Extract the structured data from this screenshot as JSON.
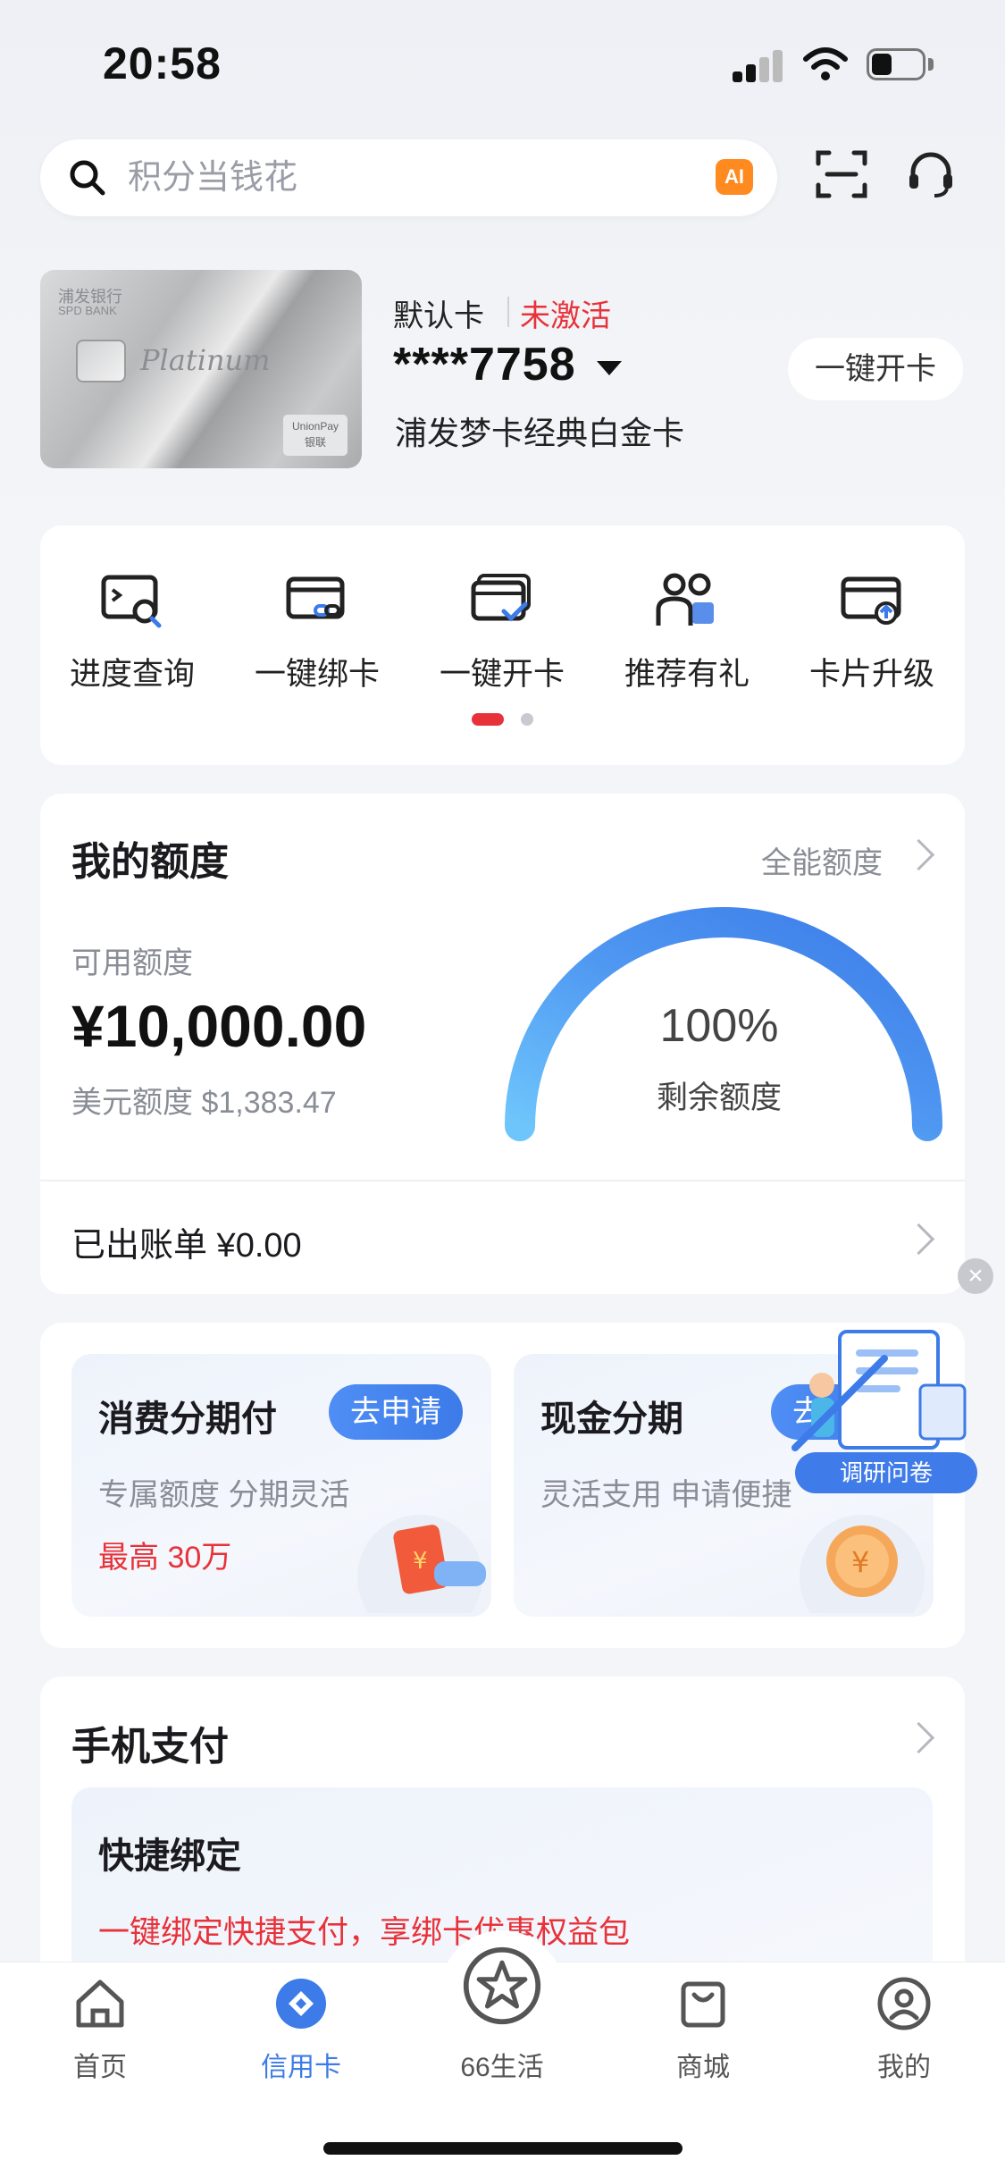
{
  "status_bar": {
    "time": "20:58"
  },
  "search": {
    "placeholder": "积分当钱花",
    "ai_badge": "AI"
  },
  "card": {
    "default_label": "默认卡",
    "status": "未激活",
    "number": "****7758",
    "name": "浦发梦卡经典白金卡",
    "open_button": "一键开卡",
    "image_text": {
      "bank_cn": "浦发银行",
      "bank_en": "SPD BANK",
      "brand": "Platinum",
      "network": "UnionPay",
      "network_cn": "银联"
    }
  },
  "shortcuts": [
    {
      "label": "进度查询",
      "icon": "progress-search-icon"
    },
    {
      "label": "一键绑卡",
      "icon": "card-bind-icon"
    },
    {
      "label": "一键开卡",
      "icon": "card-activate-icon"
    },
    {
      "label": "推荐有礼",
      "icon": "refer-gift-icon"
    },
    {
      "label": "卡片升级",
      "icon": "card-upgrade-icon"
    }
  ],
  "credit": {
    "title": "我的额度",
    "link": "全能额度",
    "available_label": "可用额度",
    "available_amount": "¥10,000.00",
    "usd_label": "美元额度 $1,383.47",
    "remaining_percent": "100%",
    "remaining_label": "剩余额度",
    "remaining_fraction": 1.0,
    "bill_label": "已出账单 ¥0.00"
  },
  "installments": [
    {
      "title": "消费分期付",
      "button": "去申请",
      "desc": "专属额度 分期灵活",
      "highlight": "最高 30万"
    },
    {
      "title": "现金分期",
      "button": "去",
      "desc": "灵活支用 申请便捷"
    }
  ],
  "float_ad": {
    "label": "调研问卷"
  },
  "mobile_pay": {
    "title": "手机支付",
    "bind_title": "快捷绑定",
    "bind_desc": "一键绑定快捷支付，享绑卡优惠权益包"
  },
  "tabbar": [
    {
      "label": "首页",
      "icon": "home-icon",
      "active": false
    },
    {
      "label": "信用卡",
      "icon": "credit-card-icon",
      "active": true
    },
    {
      "label": "66生活",
      "icon": "star-icon",
      "active": false
    },
    {
      "label": "商城",
      "icon": "shopping-bag-icon",
      "active": false
    },
    {
      "label": "我的",
      "icon": "profile-icon",
      "active": false
    }
  ],
  "colors": {
    "accent": "#3c7be8",
    "alert": "#e8323a",
    "background": "#f3f5f9"
  }
}
